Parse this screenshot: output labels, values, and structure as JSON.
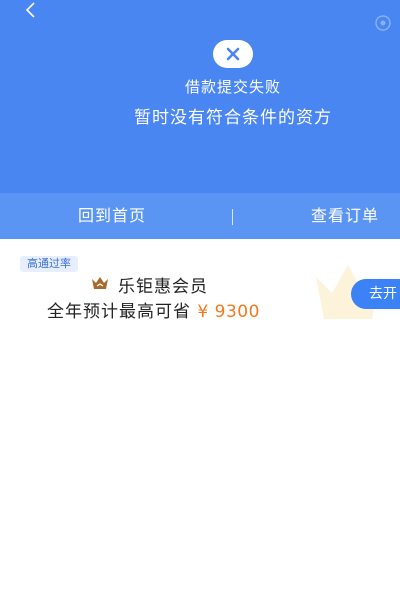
{
  "header": {
    "back_icon": "chevron-left-icon",
    "status_icon": "close-icon",
    "status_title": "借款提交失败",
    "status_desc": "暂时没有符合条件的资方",
    "background": "#4a86f2"
  },
  "actions": {
    "home_label": "回到首页",
    "orders_label": "查看订单"
  },
  "promo": {
    "badge": "高通过率",
    "crown_icon": "crown-icon",
    "title": "乐钜惠会员",
    "sub_prefix": "全年预计最高可省",
    "amount": "¥ 9300",
    "amount_color": "#f07a1d",
    "button_label": "去开"
  }
}
